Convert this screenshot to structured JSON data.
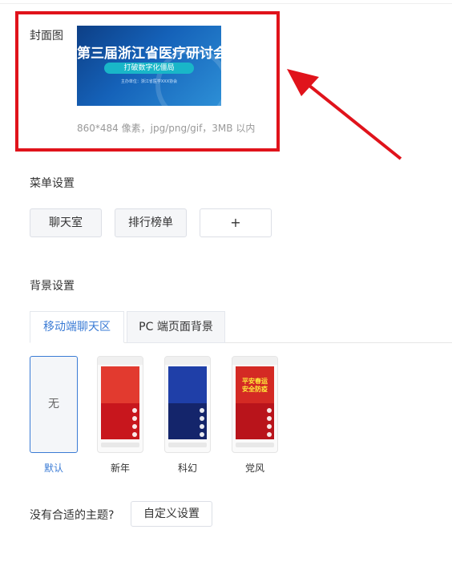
{
  "cover": {
    "label": "封面图",
    "image_title": "第三届浙江省医疗研讨会",
    "image_subtitle": "打破数字化僵局",
    "image_small_text": "主办单位：浙江省医学XXX协会",
    "hint": "860*484 像素，jpg/png/gif，3MB 以内"
  },
  "menu": {
    "title": "菜单设置",
    "items": [
      "聊天室",
      "排行榜单"
    ],
    "add_label": "+"
  },
  "background": {
    "title": "背景设置",
    "tabs": [
      {
        "label": "移动端聊天区",
        "active": true
      },
      {
        "label": "PC 端页面背景",
        "active": false
      }
    ],
    "themes": [
      {
        "label": "默认",
        "preview": "无",
        "selected": true,
        "label_color": "#3a7bd5"
      },
      {
        "label": "新年",
        "selected": false,
        "color": "#c8161d",
        "banner_color": "#e23a2f"
      },
      {
        "label": "科幻",
        "selected": false,
        "color": "#14256b",
        "banner_color": "#1f3fa8"
      },
      {
        "label": "党风",
        "selected": false,
        "color": "#b9141b",
        "banner_color": "#d42a24",
        "banner_text": "平安春运\n安全防疫"
      }
    ]
  },
  "custom": {
    "question": "没有合适的主题?",
    "button": "自定义设置"
  },
  "colors": {
    "accent": "#3a7bd5",
    "highlight_box": "#e0131b"
  }
}
